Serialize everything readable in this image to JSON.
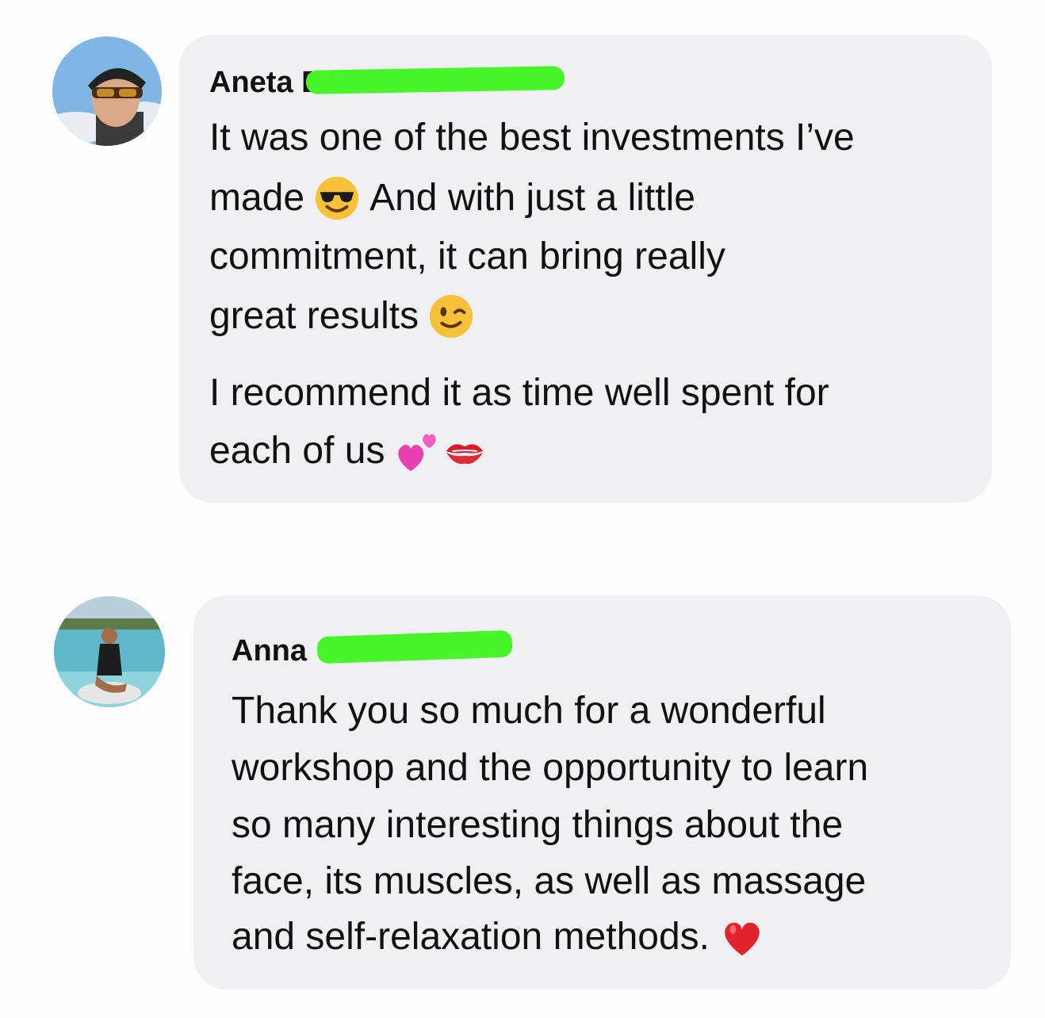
{
  "comments": [
    {
      "author_visible": "Aneta B",
      "avatar_icon": "avatar-cyclist-photo",
      "lines": [
        {
          "text": "It was one of the best investments I’ve"
        },
        {
          "text": "made",
          "emoji_after": "smiling-face-with-sunglasses",
          "text_after": "And with just a little"
        },
        {
          "text": "commitment, it can bring really"
        },
        {
          "text": "great results",
          "emoji_after": "winking-face"
        },
        {
          "text": "I recommend it as time well spent for"
        },
        {
          "text": "each of us",
          "emoji_after": "two-hearts",
          "emoji_after_2": "kiss-mark"
        }
      ]
    },
    {
      "author_visible": "Anna",
      "avatar_icon": "avatar-pool-photo",
      "lines": [
        {
          "text": "Thank you so much for a wonderful"
        },
        {
          "text": "workshop and the opportunity to learn"
        },
        {
          "text": "so many interesting things about the"
        },
        {
          "text": "face, its muscles, as well as massage"
        },
        {
          "text": "and self-relaxation methods.",
          "emoji_after": "red-heart"
        }
      ]
    }
  ],
  "colors": {
    "bubble": "#f0f0f3",
    "redaction": "#47f52a",
    "text": "#111111"
  }
}
